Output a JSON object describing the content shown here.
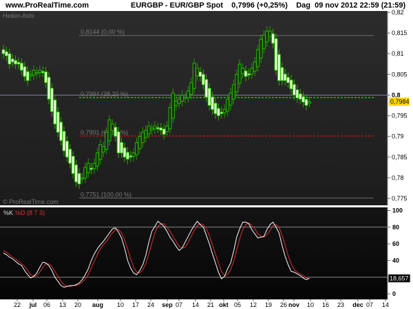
{
  "header": {
    "site": "www.ProRealTime.com",
    "instrument": "EURGBP - EUR/GBP Spot",
    "price": "0,7996",
    "change": "(+0,25%)",
    "period": "Dag",
    "datetime": "09 nov 2012 22:59 (21:59)"
  },
  "price_panel": {
    "indicator_label": "Heikin-Ashi",
    "watermark": "© ProRealTime.com",
    "y_ticks": [
      "0,82",
      "0,815",
      "0,81",
      "0,805",
      "0,8",
      "0,795",
      "0,79",
      "0,785",
      "0,78",
      "0,775"
    ],
    "y_tick_values": [
      0.82,
      0.815,
      0.81,
      0.805,
      0.8,
      0.795,
      0.79,
      0.785,
      0.78,
      0.775
    ],
    "ylim": [
      0.775,
      0.82
    ],
    "last_price_label": "0,7984",
    "last_price": 0.7984,
    "last_price_color": "#ffd700",
    "fib_levels": [
      {
        "label": "0,8144 (0,00 %)",
        "value": 0.8144,
        "color": "#6e6e6e",
        "style": "solid"
      },
      {
        "label": "0,7994 (38,20 %)",
        "value": 0.7994,
        "color": "#22cc22",
        "style": "dashed"
      },
      {
        "label": "0,7901 (61,80 %)",
        "value": 0.7901,
        "color": "#cc1111",
        "style": "dashed"
      },
      {
        "label": "0,7751 (100,00 %)",
        "value": 0.7751,
        "color": "#6e6e6e",
        "style": "solid"
      }
    ],
    "up_color": "#22bb00",
    "down_color": "#eaffd8",
    "closes": [
      0.81,
      0.8095,
      0.8075,
      0.808,
      0.8075,
      0.8075,
      0.806,
      0.8045,
      0.8035,
      0.805,
      0.806,
      0.8055,
      0.806,
      0.8055,
      0.803,
      0.799,
      0.796,
      0.793,
      0.791,
      0.789,
      0.7865,
      0.785,
      0.7835,
      0.781,
      0.779,
      0.7785,
      0.78,
      0.7825,
      0.7835,
      0.782,
      0.7835,
      0.786,
      0.788,
      0.7875,
      0.791,
      0.794,
      0.793,
      0.79,
      0.786,
      0.786,
      0.785,
      0.7845,
      0.785,
      0.786,
      0.7885,
      0.79,
      0.791,
      0.7915,
      0.7925,
      0.792,
      0.7925,
      0.792,
      0.7915,
      0.7905,
      0.7925,
      0.797,
      0.8005,
      0.7985,
      0.799,
      0.8,
      0.7995,
      0.801,
      0.803,
      0.8077,
      0.8065,
      0.8045,
      0.8025,
      0.7995,
      0.7975,
      0.7965,
      0.7955,
      0.795,
      0.7955,
      0.7965,
      0.799,
      0.8005,
      0.8025,
      0.805,
      0.8075,
      0.8065,
      0.8045,
      0.805,
      0.8065,
      0.808,
      0.811,
      0.8135,
      0.8145,
      0.8155,
      0.8155,
      0.8125,
      0.806,
      0.8035,
      0.8035,
      0.8035,
      0.803,
      0.8015,
      0.8,
      0.7993,
      0.799,
      0.7983,
      0.7975,
      0.7984
    ]
  },
  "stoch_panel": {
    "label_k": "%K",
    "label_d": "%D (8 7 3)",
    "k_color": "#ffffff",
    "d_color": "#e03030",
    "y_ticks": [
      "100",
      "80",
      "60",
      "40",
      "20",
      "0"
    ],
    "y_tick_values": [
      100,
      80,
      60,
      40,
      20,
      0
    ],
    "levels": [
      80,
      20
    ],
    "last_value_label": "18,657",
    "k": [
      49,
      47,
      44,
      42,
      39,
      36,
      34,
      28,
      23,
      19,
      21,
      25,
      32,
      38,
      37,
      34,
      28,
      20,
      15,
      10,
      8,
      9,
      10,
      10,
      11,
      13,
      17,
      23,
      30,
      40,
      48,
      54,
      59,
      63,
      68,
      73,
      78,
      79,
      74,
      67,
      55,
      40,
      31,
      25,
      23,
      28,
      35,
      46,
      62,
      75,
      81,
      87,
      84,
      81,
      75,
      68,
      63,
      57,
      52,
      55,
      62,
      69,
      76,
      82,
      87,
      83,
      80,
      70,
      60,
      48,
      37,
      26,
      18,
      21,
      30,
      37,
      51,
      68,
      78,
      86,
      86,
      84,
      77,
      72,
      67,
      68,
      69,
      77,
      83,
      86,
      80,
      73,
      58,
      45,
      35,
      27,
      26,
      24,
      22,
      19,
      17,
      18.657
    ],
    "d": [
      52,
      50,
      47,
      44,
      42,
      39,
      36,
      33,
      28,
      23,
      21,
      22,
      26,
      32,
      36,
      36,
      33,
      27,
      21,
      15,
      11,
      9,
      9,
      10,
      10,
      11,
      14,
      18,
      23,
      31,
      39,
      47,
      54,
      59,
      63,
      68,
      73,
      77,
      77,
      73,
      65,
      54,
      42,
      32,
      26,
      25,
      29,
      36,
      48,
      61,
      73,
      81,
      84,
      84,
      80,
      75,
      69,
      63,
      57,
      55,
      56,
      62,
      69,
      76,
      82,
      84,
      83,
      78,
      70,
      59,
      48,
      37,
      27,
      22,
      23,
      29,
      39,
      52,
      66,
      77,
      83,
      85,
      82,
      78,
      72,
      69,
      68,
      71,
      76,
      82,
      83,
      80,
      70,
      59,
      46,
      36,
      29,
      26,
      24,
      22,
      19,
      18
    ]
  },
  "x_axis": {
    "labels": [
      "22",
      "jul",
      "06",
      "13",
      "20",
      "aug",
      "10",
      "17",
      "24",
      "sep",
      "07",
      "14",
      "21",
      "okt",
      "05",
      "12",
      "19",
      "26",
      "nov",
      "10",
      "16",
      "23",
      "dec",
      "07",
      "14"
    ],
    "month_labels": [
      "jul",
      "aug",
      "sep",
      "okt",
      "nov",
      "dec"
    ]
  }
}
